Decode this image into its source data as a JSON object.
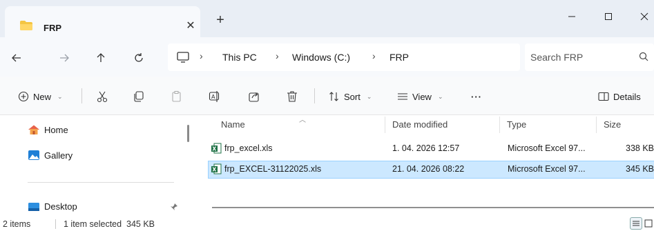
{
  "window": {
    "tab_title": "FRP",
    "tab_close": "✕",
    "new_tab": "+"
  },
  "address": {
    "crumbs": [
      "This PC",
      "Windows (C:)",
      "FRP"
    ],
    "separator": "›",
    "search_placeholder": "Search FRP"
  },
  "toolbar": {
    "new_label": "New",
    "sort_label": "Sort",
    "view_label": "View",
    "more_label": "···",
    "details_label": "Details",
    "chevron": "⌄"
  },
  "sidebar": {
    "items": [
      {
        "label": "Home"
      },
      {
        "label": "Gallery"
      },
      {
        "label": "Desktop"
      }
    ]
  },
  "columns": {
    "name": "Name",
    "date": "Date modified",
    "type": "Type",
    "size": "Size"
  },
  "files": [
    {
      "name": "frp_excel.xls",
      "date": "1. 04. 2026 12:57",
      "type": "Microsoft Excel 97...",
      "size": "338 KB",
      "selected": false
    },
    {
      "name": "frp_EXCEL-31122025.xls",
      "date": "21. 04. 2026 08:22",
      "type": "Microsoft Excel 97...",
      "size": "345 KB",
      "selected": true
    }
  ],
  "status": {
    "count": "2 items",
    "selection": "1 item selected  345 KB"
  },
  "colors": {
    "accent": "#0067c0",
    "selection": "#cce8ff",
    "excel_green": "#1e7145",
    "folder_yellow": "#f4c542"
  }
}
